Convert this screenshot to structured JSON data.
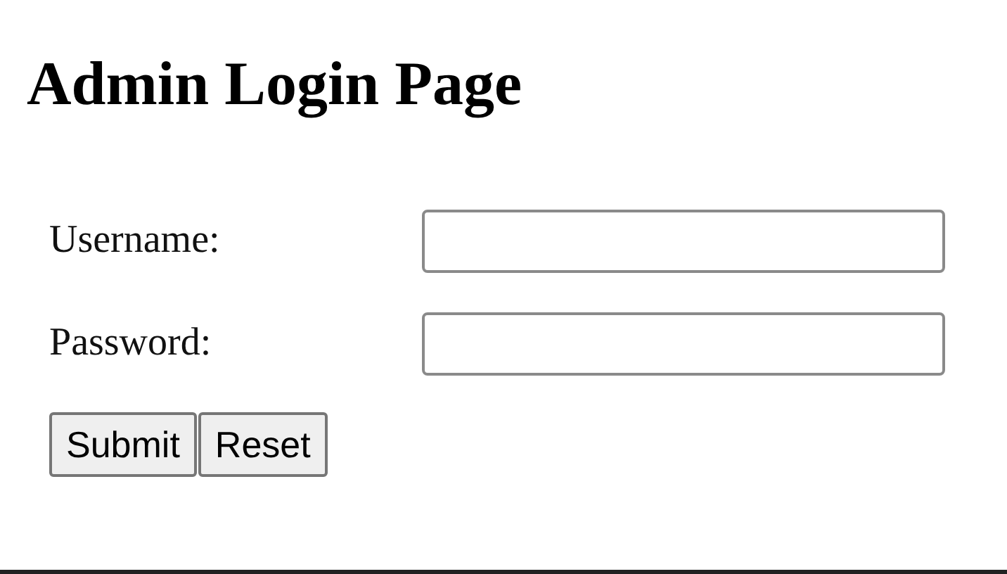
{
  "heading": "Admin Login Page",
  "fields": [
    {
      "label": "Username:"
    },
    {
      "label": "Password:"
    }
  ],
  "buttons": [
    "Submit",
    "Reset"
  ]
}
